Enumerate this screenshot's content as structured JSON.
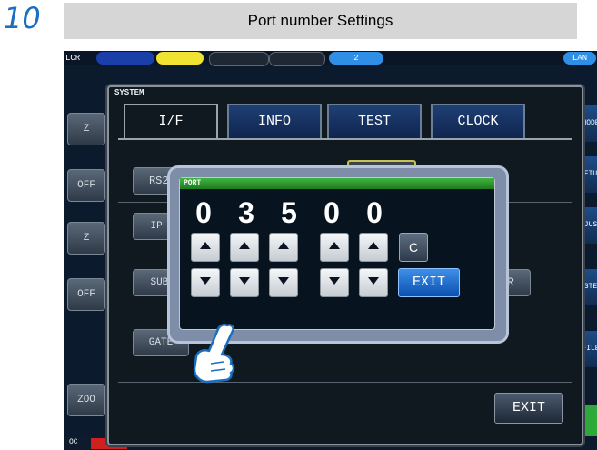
{
  "step": {
    "number": "10",
    "title": "Port number Settings"
  },
  "screen": {
    "mode_label": "LCR",
    "lan_label": "LAN",
    "topbar_num": "2",
    "bg_buttons": [
      "Z",
      "OFF",
      "Z",
      "OFF",
      "ZOO"
    ],
    "bg_partial": [
      "RS232",
      "IP AD",
      "SUBNE",
      "GATE",
      "CR"
    ],
    "right_side": [
      "MODE",
      "SETUP",
      "DJUST",
      "YSTEM",
      "FILE"
    ],
    "bottom_left": [
      "OC",
      "OC"
    ]
  },
  "system": {
    "title": "SYSTEM",
    "tabs": [
      "I/F",
      "INFO",
      "TEST",
      "CLOCK"
    ],
    "exit_label": "EXIT"
  },
  "port_dialog": {
    "title": "PORT",
    "digits": [
      "0",
      "3",
      "5",
      "0",
      "0"
    ],
    "clear_label": "C",
    "exit_label": "EXIT"
  },
  "colors": {
    "accent": "#1a6fc0",
    "title_bar_green": "#2f9a2f",
    "exit_blue": "#1b65c8"
  }
}
